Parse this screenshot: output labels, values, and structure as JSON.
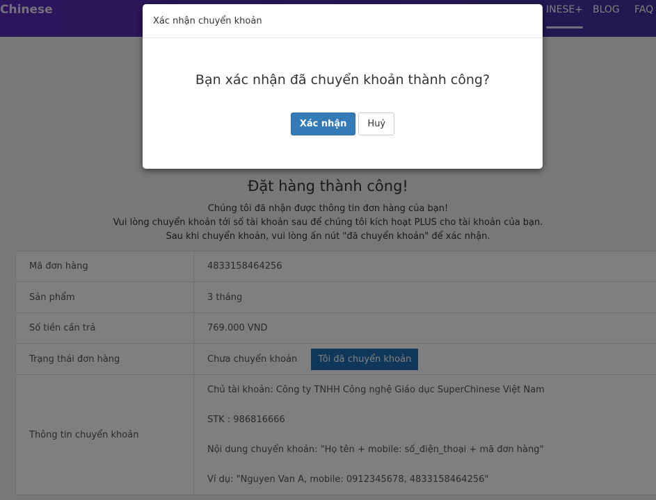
{
  "nav": {
    "brand": "Chinese",
    "items": [
      "INESE+",
      "BLOG",
      "FAQ"
    ]
  },
  "content": {
    "title": "Đặt hàng thành công!",
    "messages": [
      "Chúng tôi đã nhận được thông tin đơn hàng của bạn!",
      "Vui lòng chuyển khoản tới số tài khoản sau để chúng tôi kích hoạt PLUS cho tài khoản của bạn.",
      "Sau khi chuyển khoản, vui lòng ấn nút \"đã chuyển khoản\" để xác nhận."
    ]
  },
  "order": {
    "order_id": {
      "label": "Mã đơn hàng",
      "value": "4833158464256"
    },
    "product": {
      "label": "Sản phẩm",
      "value": "3 tháng"
    },
    "amount": {
      "label": "Số tiền cần trả",
      "value": "769.000 VND"
    },
    "status": {
      "label": "Trạng thái đơn hàng",
      "value": "Chưa chuyển khoản",
      "button": "Tôi đã chuyển khoản"
    },
    "bank": {
      "label": "Thông tin chuyển khoản",
      "lines": [
        "Chủ tài khoản: Công ty TNHH Công nghệ Giáo dục SuperChinese Việt Nam",
        "STK : 986816666",
        "Nội dung chuyển khoản: \"Họ tên + mobile: số_điện_thoại + mã đơn hàng\"",
        "Ví dụ: \"Nguyen Van A, mobile: 0912345678, 4833158464256\""
      ]
    }
  },
  "modal": {
    "title": "Xác nhận chuyển khoản",
    "question": "Bạn xác nhận đã chuyển khoản thành công?",
    "confirm_label": "Xác nhận",
    "cancel_label": "Huỷ"
  }
}
